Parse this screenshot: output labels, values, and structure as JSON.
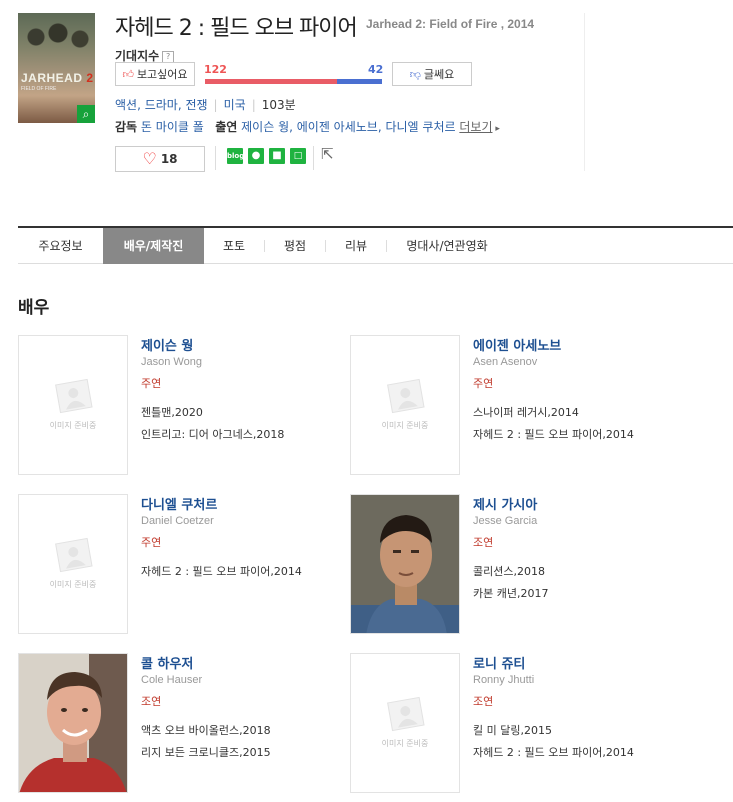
{
  "movie": {
    "title": "자헤드 2 : 필드 오브 파이어",
    "title_en": "Jarhead 2: Field of Fire , 2014",
    "poster_text": "JARHEAD",
    "poster_num": "2",
    "poster_sub": "FIELD OF FIRE"
  },
  "expect": {
    "label": "기대지수",
    "help": "?",
    "want_label": "보고싶어요",
    "dislike_label": "글쎄요",
    "want_count": "122",
    "dislike_count": "42",
    "want_ratio": 0.744
  },
  "info": {
    "genre": "액션, 드라마, 전쟁",
    "country": "미국",
    "runtime": "103분",
    "director_label": "감독",
    "director": "돈 마이클 폴",
    "cast_label": "출연",
    "cast": "제이슨 웡, 에이젠 아세노브, 다니엘 쿠처르",
    "more": "더보기"
  },
  "actions": {
    "like_count": "18",
    "share_icons": [
      "blog",
      "band",
      "kakao",
      "memo"
    ]
  },
  "colors": {
    "accent_red": "#e95c66",
    "accent_blue": "#4a6fd1",
    "link": "#1d4f91"
  },
  "tabs": [
    "주요정보",
    "배우/제작진",
    "포토",
    "평점",
    "리뷰",
    "명대사/연관영화"
  ],
  "active_tab": "배우/제작진",
  "section": {
    "title": "배우"
  },
  "placeholder_text": "이미지 준비중",
  "cast": [
    {
      "name": "제이슨 웡",
      "name_en": "Jason Wong",
      "role": "주연",
      "works": [
        "젠틀맨,2020",
        "인트리고: 디어 아그네스,2018"
      ]
    },
    {
      "name": "에이젠 아세노브",
      "name_en": "Asen Asenov",
      "role": "주연",
      "works": [
        "스나이퍼 레거시,2014",
        "자헤드 2 : 필드 오브 파이어,2014"
      ]
    },
    {
      "name": "다니엘 쿠처르",
      "name_en": "Daniel Coetzer",
      "role": "주연",
      "works": [
        "자헤드 2 : 필드 오브 파이어,2014"
      ]
    },
    {
      "name": "제시 가시아",
      "name_en": "Jesse Garcia",
      "role": "조연",
      "works": [
        "콜리션스,2018",
        "카본 캐년,2017"
      ]
    },
    {
      "name": "콜 하우저",
      "name_en": "Cole Hauser",
      "role": "조연",
      "works": [
        "액츠 오브 바이올런스,2018",
        "리지 보든 크로니클즈,2015"
      ]
    },
    {
      "name": "로니 쥬티",
      "name_en": "Ronny Jhutti",
      "role": "조연",
      "works": [
        "킬 미 달링,2015",
        "자헤드 2 : 필드 오브 파이어,2014"
      ]
    }
  ]
}
